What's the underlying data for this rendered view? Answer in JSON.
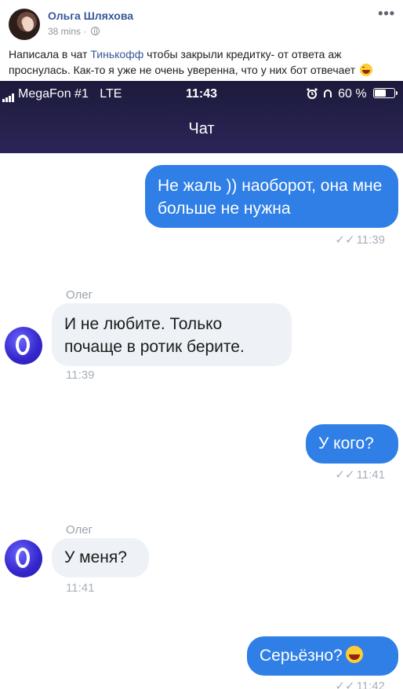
{
  "post": {
    "author": "Ольга Шляхова",
    "time": "38 mins",
    "time_sep": "·",
    "more_label": "•••",
    "text_before_link": "Написала в чат ",
    "link_text": "Тинькофф",
    "text_after_link": " чтобы закрыли кредитку- от ответа аж проснулась. Как-то я уже не очень уверенна, что у них бот отвечает"
  },
  "statusbar": {
    "carrier": "MegaFon #1",
    "network": "LTE",
    "clock": "11:43",
    "battery": "60 %",
    "battery_level": 0.6
  },
  "chat": {
    "title": "Чат",
    "messages": [
      {
        "side": "out",
        "text": "Не жаль )) наоборот, она мне больше не нужна",
        "time": "11:39",
        "check": "✓✓"
      },
      {
        "side": "in",
        "sender": "Олег",
        "text": "И не любите. Только почаще в ротик берите.",
        "time": "11:39",
        "avatar_letter": ""
      },
      {
        "side": "out",
        "text": "У кого?",
        "time": "11:41",
        "check": "✓✓"
      },
      {
        "side": "in",
        "sender": "Олег",
        "text": "У меня?",
        "time": "11:41"
      },
      {
        "side": "out",
        "text": "Серьёзно?",
        "time": "11:42",
        "check": "✓✓"
      }
    ]
  },
  "icons": {
    "globe": "globe-icon",
    "alarm": "alarm-icon",
    "lock": "rotation-lock-icon",
    "laugh": "laughing-emoji-icon"
  },
  "colors": {
    "fb_link": "#385898",
    "header_bg": "#1c1a3b",
    "outgoing_bubble": "#2f7fe6",
    "incoming_bubble": "#eef1f6",
    "bot_avatar": "#3325c9"
  }
}
